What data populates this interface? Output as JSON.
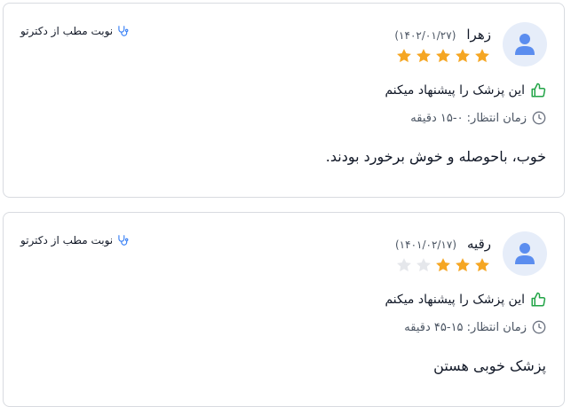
{
  "reviews": [
    {
      "name": "زهرا",
      "date": "(۱۴۰۲/۰۱/۲۷)",
      "rating": 5,
      "recommend_text": "این پزشک را پیشنهاد میکنم",
      "wait_text": "زمان انتظار: ۰-۱۵ دقیقه",
      "comment": "خوب، باحوصله و خوش برخورد بودند.",
      "book_link": "نوبت مطب از دکترتو"
    },
    {
      "name": "رقیه",
      "date": "(۱۴۰۱/۰۲/۱۷)",
      "rating": 3,
      "recommend_text": "این پزشک را پیشنهاد میکنم",
      "wait_text": "زمان انتظار: ۱۵-۴۵ دقیقه",
      "comment": "پزشک خوبی هستن",
      "book_link": "نوبت مطب از دکترتو"
    }
  ],
  "colors": {
    "star_filled": "#f5a623",
    "star_empty": "#e5e7eb",
    "thumb": "#22a447",
    "link_icon": "#3b82f6",
    "avatar_bg": "#e6edf9",
    "avatar_icon": "#5b8def"
  },
  "icons": {
    "avatar": "user-icon",
    "recommend": "thumbs-up-icon",
    "wait": "clock-icon",
    "book": "stethoscope-icon"
  }
}
